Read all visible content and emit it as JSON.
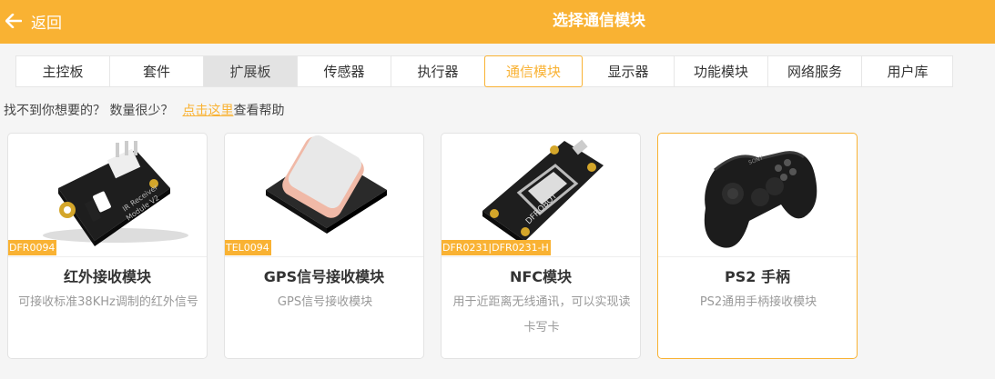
{
  "header": {
    "back_label": "返回",
    "title": "选择通信模块",
    "accent": "#f9b233"
  },
  "tabs": [
    {
      "label": "主控板"
    },
    {
      "label": "套件"
    },
    {
      "label": "扩展板"
    },
    {
      "label": "传感器"
    },
    {
      "label": "执行器"
    },
    {
      "label": "通信模块",
      "active": true
    },
    {
      "label": "显示器"
    },
    {
      "label": "功能模块"
    },
    {
      "label": "网络服务"
    },
    {
      "label": "用户库"
    }
  ],
  "help": {
    "prefix": "找不到你想要的？ 数量很少？",
    "link": "点击这里",
    "suffix": "查看帮助"
  },
  "cards": [
    {
      "sku": "DFR0094",
      "name": "红外接收模块",
      "desc": "可接收标准38KHz调制的红外信号",
      "image": "ir-receiver-board"
    },
    {
      "sku": "TEL0094",
      "name": "GPS信号接收模块",
      "desc": "GPS信号接收模块",
      "image": "gps-antenna"
    },
    {
      "sku": "DFR0231|DFR0231-H",
      "name": "NFC模块",
      "desc": "用于近距离无线通讯，可以实现读卡写卡",
      "image": "nfc-board"
    },
    {
      "sku": "",
      "name": "PS2 手柄",
      "desc": "PS2通用手柄接收模块",
      "image": "gamepad",
      "selected": true
    }
  ]
}
